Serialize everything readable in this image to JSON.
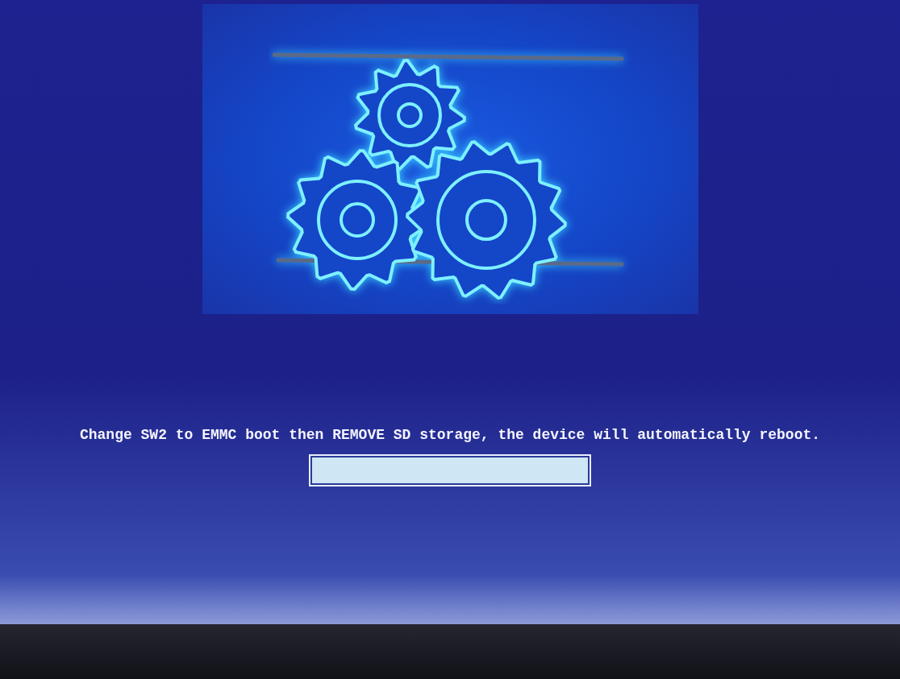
{
  "message": "Change SW2 to EMMC boot then REMOVE SD storage, the device will automatically reboot.",
  "progress": {
    "level": 1
  }
}
